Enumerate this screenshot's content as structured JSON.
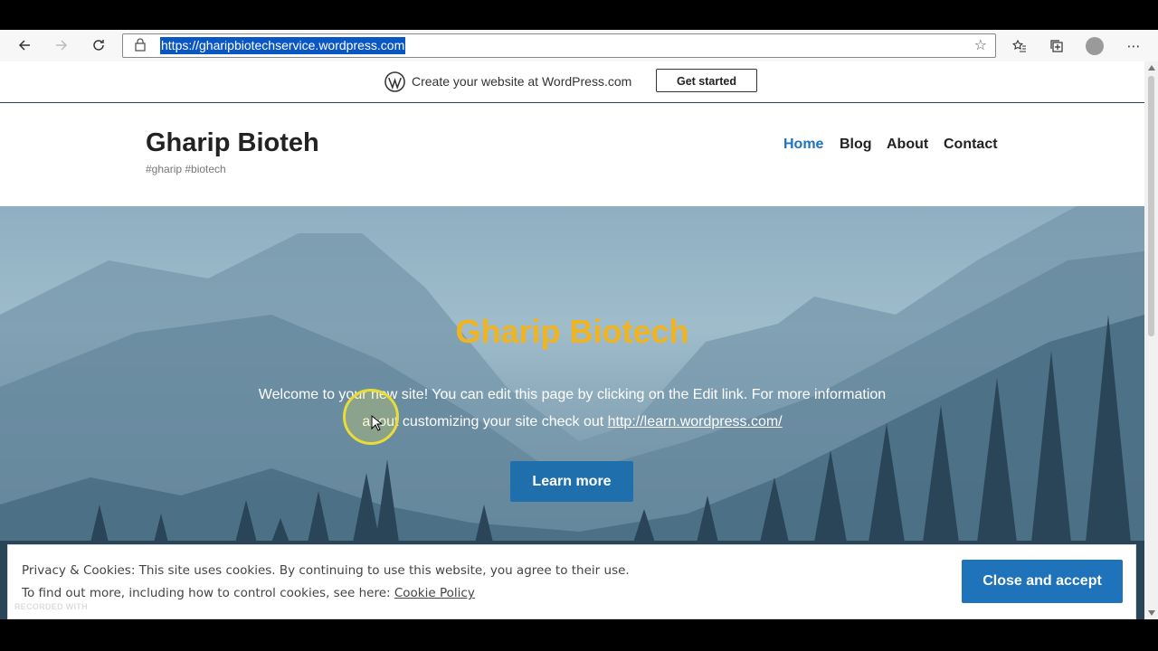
{
  "browser": {
    "url": "https://gharipbiotechservice.wordpress.com",
    "back_icon": "arrow-left-icon",
    "forward_icon": "arrow-right-icon",
    "refresh_icon": "refresh-icon"
  },
  "wpbar": {
    "text": "Create your website at WordPress.com",
    "button": "Get started"
  },
  "site": {
    "title": "Gharip Bioteh",
    "tagline": "#gharip #biotech"
  },
  "menu": {
    "items": [
      "Home",
      "Blog",
      "About",
      "Contact"
    ],
    "active": "Home"
  },
  "hero": {
    "title": "Gharip Biotech",
    "text": "Welcome to your new site! You can edit this page by clicking on the Edit link. For more information about customizing your site check out ",
    "link": "http://learn.wordpress.com/",
    "button": "Learn more"
  },
  "cookie": {
    "line1": "Privacy & Cookies: This site uses cookies. By continuing to use this website, you agree to their use.",
    "line2": "To find out more, including how to control cookies, see here: ",
    "policy_link": "Cookie Policy",
    "accept": "Close and accept"
  },
  "watermark": "RECORDED WITH",
  "colors": {
    "accent": "#1e73be",
    "hero_title": "#f0b322",
    "url_highlight": "#0a56c2"
  }
}
